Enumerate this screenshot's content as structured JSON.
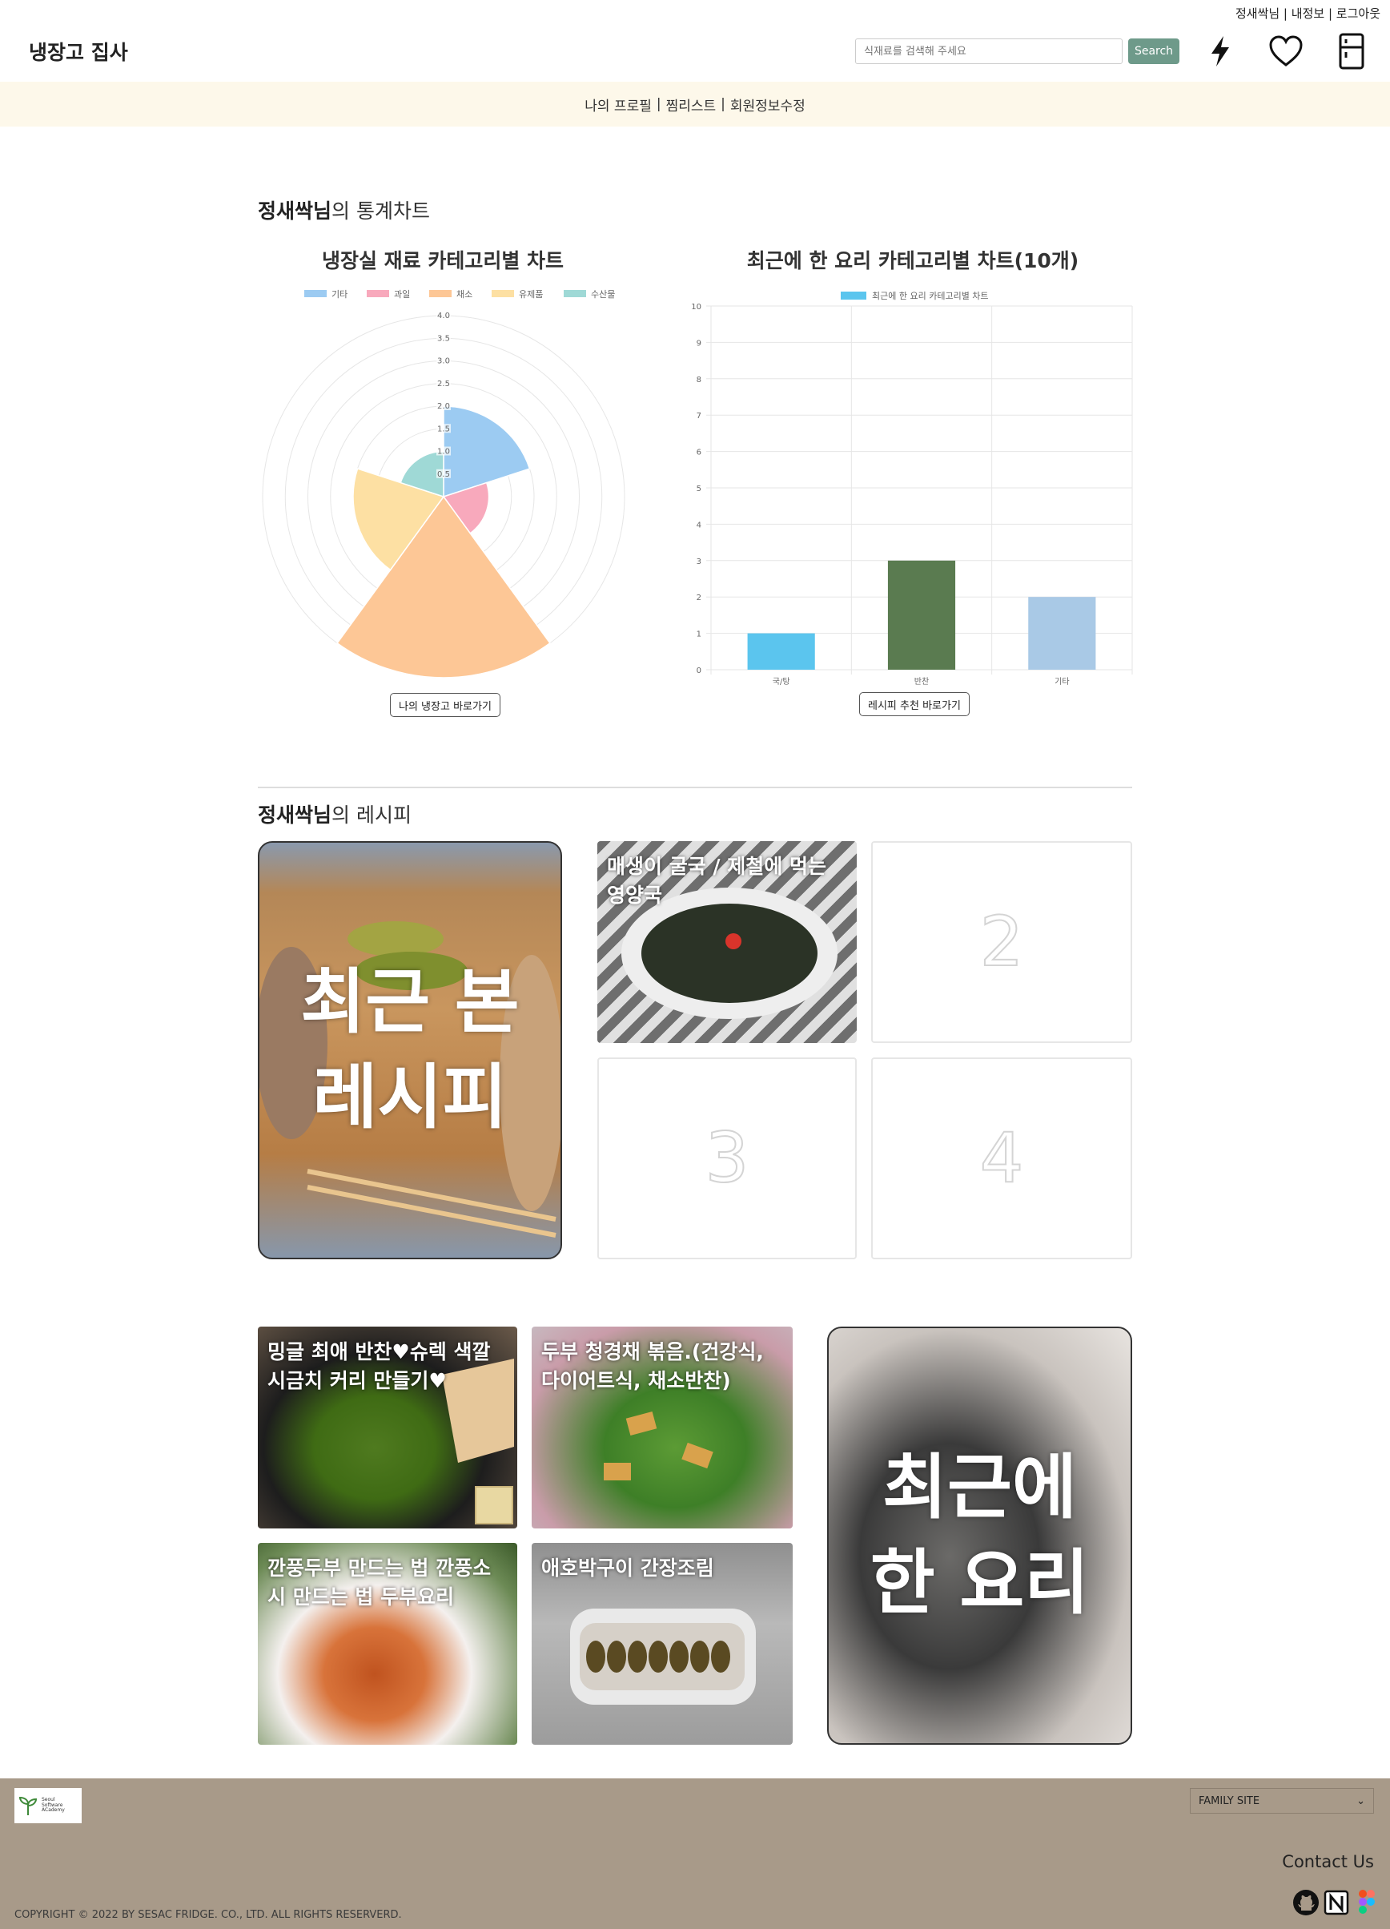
{
  "header": {
    "util_user": "정새싹님",
    "util_myinfo": "내정보",
    "util_logout": "로그아웃",
    "util_sep": "|",
    "logo": "냉장고 집사",
    "search_placeholder": "식재료를 검색해 주세요",
    "search_button": "Search",
    "icons": [
      "bolt-icon",
      "heart-icon",
      "fridge-icon"
    ]
  },
  "subnav": {
    "items": [
      "나의 프로필",
      "찜리스트",
      "회원정보수정"
    ],
    "sep": "|"
  },
  "stats": {
    "user_name": "정새싹님",
    "title_suffix": "의 통계차트",
    "left_title": "냉장실 재료 카테고리별 차트",
    "right_title": "최근에 한 요리 카테고리별 차트(10개)",
    "left_button": "나의 냉장고 바로가기",
    "right_button": "레시피 추천 바로가기"
  },
  "chart_data": [
    {
      "type": "polarArea",
      "title": "냉장실 재료 카테고리별 차트",
      "categories": [
        "기타",
        "과일",
        "채소",
        "유제품",
        "수산물"
      ],
      "values": [
        2.0,
        1.0,
        4.0,
        2.0,
        1.0
      ],
      "colors": [
        "#9ccbf2",
        "#f8a9bc",
        "#fdc796",
        "#fde0a3",
        "#9fd9d6"
      ],
      "rlim": [
        0,
        4
      ],
      "ticks": [
        "0.5",
        "1.0",
        "1.5",
        "2.0",
        "2.5",
        "3.0",
        "3.5",
        "4.0"
      ],
      "legend": "top"
    },
    {
      "type": "bar",
      "title": "최근에 한 요리 카테고리별 차트(10개)",
      "categories": [
        "국/탕",
        "반찬",
        "기타"
      ],
      "series": [
        {
          "name": "최근에 한 요리 카테고리별 차트",
          "values": [
            1,
            3,
            2
          ]
        }
      ],
      "colors": [
        "#5bc5ee",
        "#5a7b50",
        "#a9c9e6"
      ],
      "legend_color": "#5bc5ee",
      "ylim": [
        0,
        10
      ],
      "yticks": [
        "0",
        "1",
        "2",
        "3",
        "4",
        "5",
        "6",
        "7",
        "8",
        "9",
        "10"
      ],
      "grid": true,
      "legend": "top"
    }
  ],
  "recipes": {
    "user_name": "정새싹님",
    "title_suffix": "의 레시피",
    "recent_viewed_label": "최근 본\n레시피",
    "recent_viewed": [
      {
        "title": "매생이 굴국 / 제철에 먹는 영양국"
      }
    ],
    "placeholders": [
      "2",
      "3",
      "4"
    ],
    "recent_cooked_label": "최근에\n한 요리",
    "recent_cooked": [
      {
        "title": "밍글 최애 반찬♥슈렉 색깔 시금치 커리 만들기♥"
      },
      {
        "title": "두부 청경채 볶음.(건강식, 다이어트식, 채소반찬)"
      },
      {
        "title": "깐풍두부 만드는 법 깐풍소시 만드는 법 두부요리"
      },
      {
        "title": "애호박구이 간장조림"
      }
    ]
  },
  "footer": {
    "logo_text": [
      "Seoul",
      "Software",
      "ACademy"
    ],
    "family_site": "FAMILY SITE",
    "contact": "Contact Us",
    "copyright": "COPYRIGHT © 2022 BY SESAC FRIDGE. CO., LTD. ALL RIGHTS RESERVERD.",
    "icons": [
      "github-icon",
      "notion-icon",
      "figma-icon"
    ]
  }
}
